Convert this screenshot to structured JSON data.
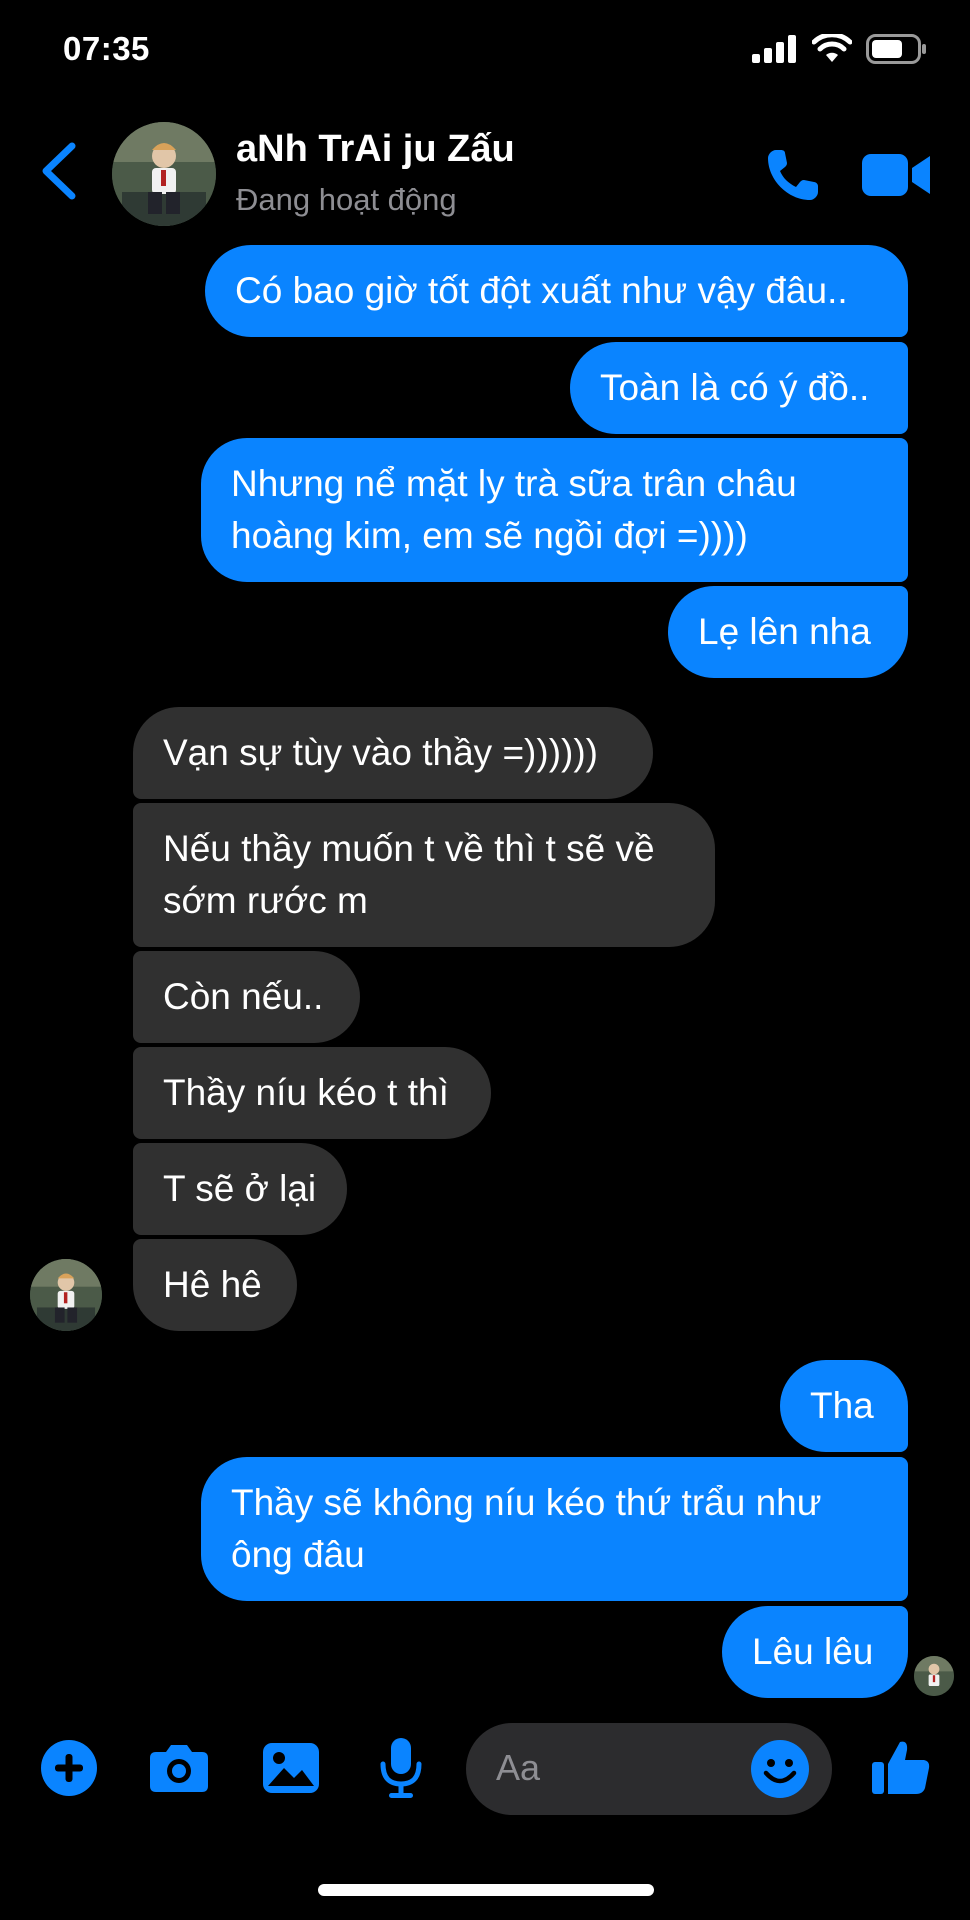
{
  "status_bar": {
    "time": "07:35"
  },
  "header": {
    "contact_name": "aNh TrAi ju Zấu",
    "contact_status": "Đang hoạt động"
  },
  "messages": [
    {
      "side": "out",
      "text": "Có bao giờ tốt đột xuất như vậy đâu.."
    },
    {
      "side": "out",
      "text": "Toàn là có ý đồ.."
    },
    {
      "side": "out",
      "text": "Nhưng nể mặt ly trà sữa trân châu\nhoàng kim, em sẽ ngồi đợi =))))"
    },
    {
      "side": "out",
      "text": "Lẹ lên nha"
    },
    {
      "side": "in",
      "text": "Vạn sự tùy vào thầy =))))))"
    },
    {
      "side": "in",
      "text": "Nếu thầy muốn t về thì t sẽ về\nsớm rước m"
    },
    {
      "side": "in",
      "text": "Còn nếu.."
    },
    {
      "side": "in",
      "text": "Thầy níu kéo t thì"
    },
    {
      "side": "in",
      "text": "T sẽ ở lại"
    },
    {
      "side": "in",
      "text": "Hê hê"
    },
    {
      "side": "out",
      "text": "Tha"
    },
    {
      "side": "out",
      "text": "Thầy sẽ không níu kéo thứ trẩu như\nông đâu"
    },
    {
      "side": "out",
      "text": "Lêu lêu"
    }
  ],
  "composer": {
    "placeholder": "Aa",
    "icons": [
      "plus-icon",
      "camera-icon",
      "gallery-icon",
      "microphone-icon",
      "emoji-icon",
      "thumbs-up-icon"
    ]
  },
  "colors": {
    "accent": "#0a84ff",
    "incoming_bubble": "#303030",
    "background": "#000000",
    "secondary_text": "#8e8e93"
  }
}
